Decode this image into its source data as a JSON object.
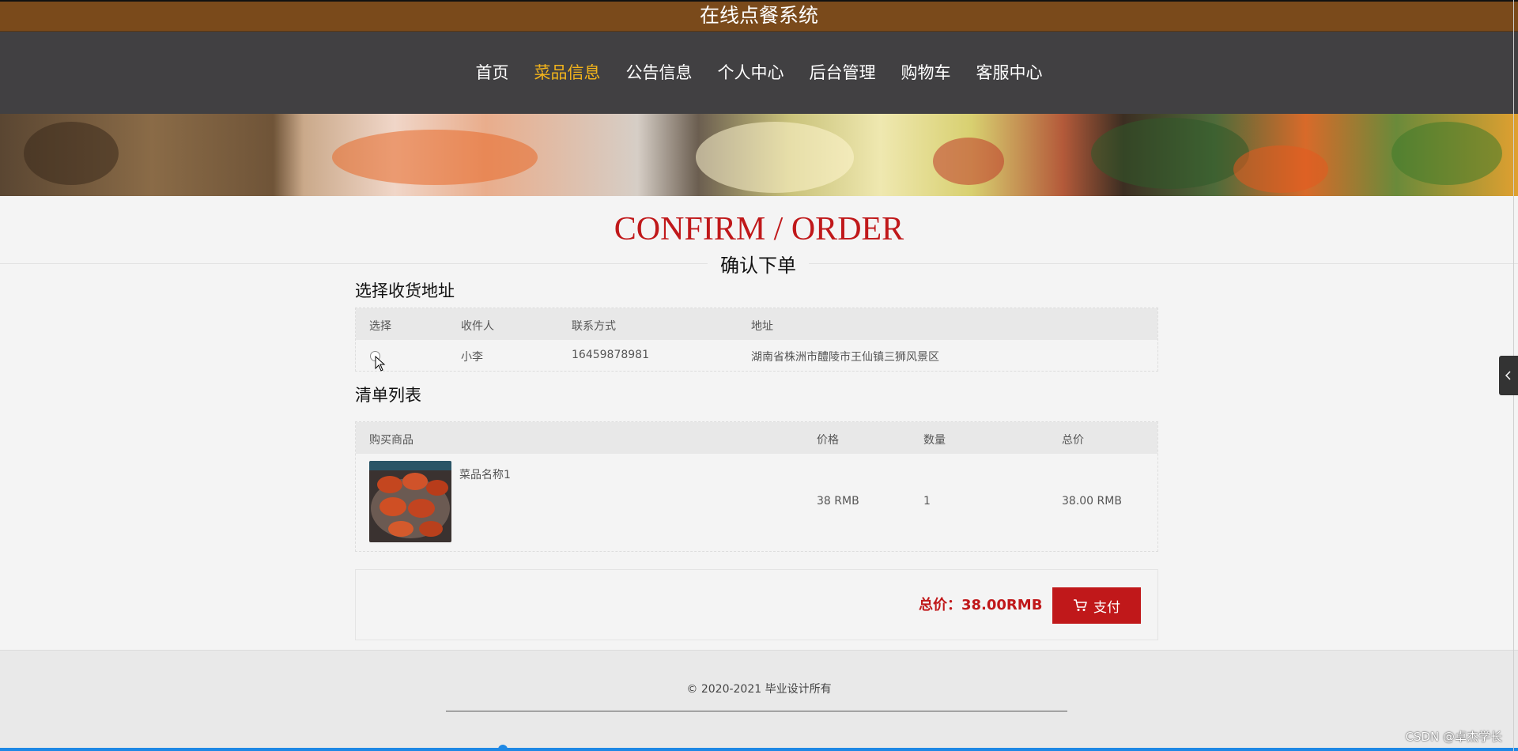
{
  "header": {
    "title": "在线点餐系统"
  },
  "nav": {
    "items": [
      "首页",
      "菜品信息",
      "公告信息",
      "个人中心",
      "后台管理",
      "购物车",
      "客服中心"
    ],
    "active_index": 1
  },
  "page": {
    "title_en": "CONFIRM / ORDER",
    "title_cn": "确认下单"
  },
  "address": {
    "section_title": "选择收货地址",
    "columns": {
      "select": "选择",
      "receiver": "收件人",
      "contact": "联系方式",
      "address": "地址"
    },
    "rows": [
      {
        "receiver": "小李",
        "contact": "16459878981",
        "address": "湖南省株洲市醴陵市王仙镇三狮风景区",
        "selected": false
      }
    ]
  },
  "order_list": {
    "section_title": "清单列表",
    "columns": {
      "product": "购买商品",
      "price": "价格",
      "quantity": "数量",
      "total": "总价"
    },
    "rows": [
      {
        "name": "菜品名称1",
        "price": "38 RMB",
        "quantity": "1",
        "total": "38.00 RMB"
      }
    ]
  },
  "summary": {
    "total_text": "总价：38.00RMB",
    "pay_label": "支付"
  },
  "footer": {
    "copyright": "© 2020-2021 毕业设计所有"
  },
  "watermark": "CSDN @卓杰学长",
  "colors": {
    "brand_bar": "#7a4a1b",
    "nav_bg": "#414042",
    "nav_active": "#f3b41b",
    "accent_red": "#c0181a"
  }
}
